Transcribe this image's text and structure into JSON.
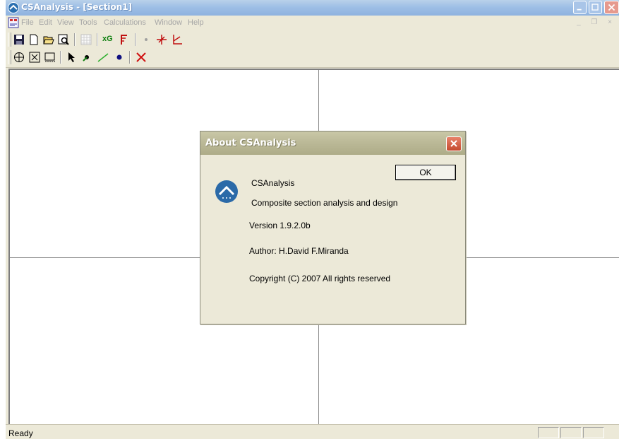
{
  "window": {
    "title": "CSAnalysis - [Section1]"
  },
  "menu": {
    "items": [
      "File",
      "Edit",
      "View",
      "Tools",
      "Calculations",
      "Window",
      "Help"
    ],
    "mdi_controls": "_ ❐ ×"
  },
  "toolbar1": {
    "buttons": [
      "save-icon",
      "new-icon",
      "open-icon",
      "print-preview-icon",
      "grid-icon",
      "xg-icon",
      "section-icon",
      "point-icon",
      "axes-cross-icon",
      "axes-corner-icon"
    ],
    "xg_label": "xG"
  },
  "toolbar2": {
    "buttons": [
      "pan-icon",
      "zoom-extents-icon",
      "zoom-window-icon",
      "select-arrow-icon",
      "node-icon",
      "line-icon",
      "dot-icon",
      "delete-x-icon"
    ]
  },
  "status": {
    "text": "Ready"
  },
  "about": {
    "title": "About CSAnalysis",
    "ok_label": "OK",
    "app_name": "CSAnalysis",
    "description": "Composite section analysis and design",
    "version": "Version 1.9.2.0b",
    "author": "Author: H.David F.Miranda",
    "copyright": "Copyright (C) 2007 All rights reserved"
  },
  "colors": {
    "titlebar": "#9ebfe6",
    "dialog_titlebar": "#bab896",
    "close_button": "#c54a2f",
    "background": "#ece9d8"
  }
}
